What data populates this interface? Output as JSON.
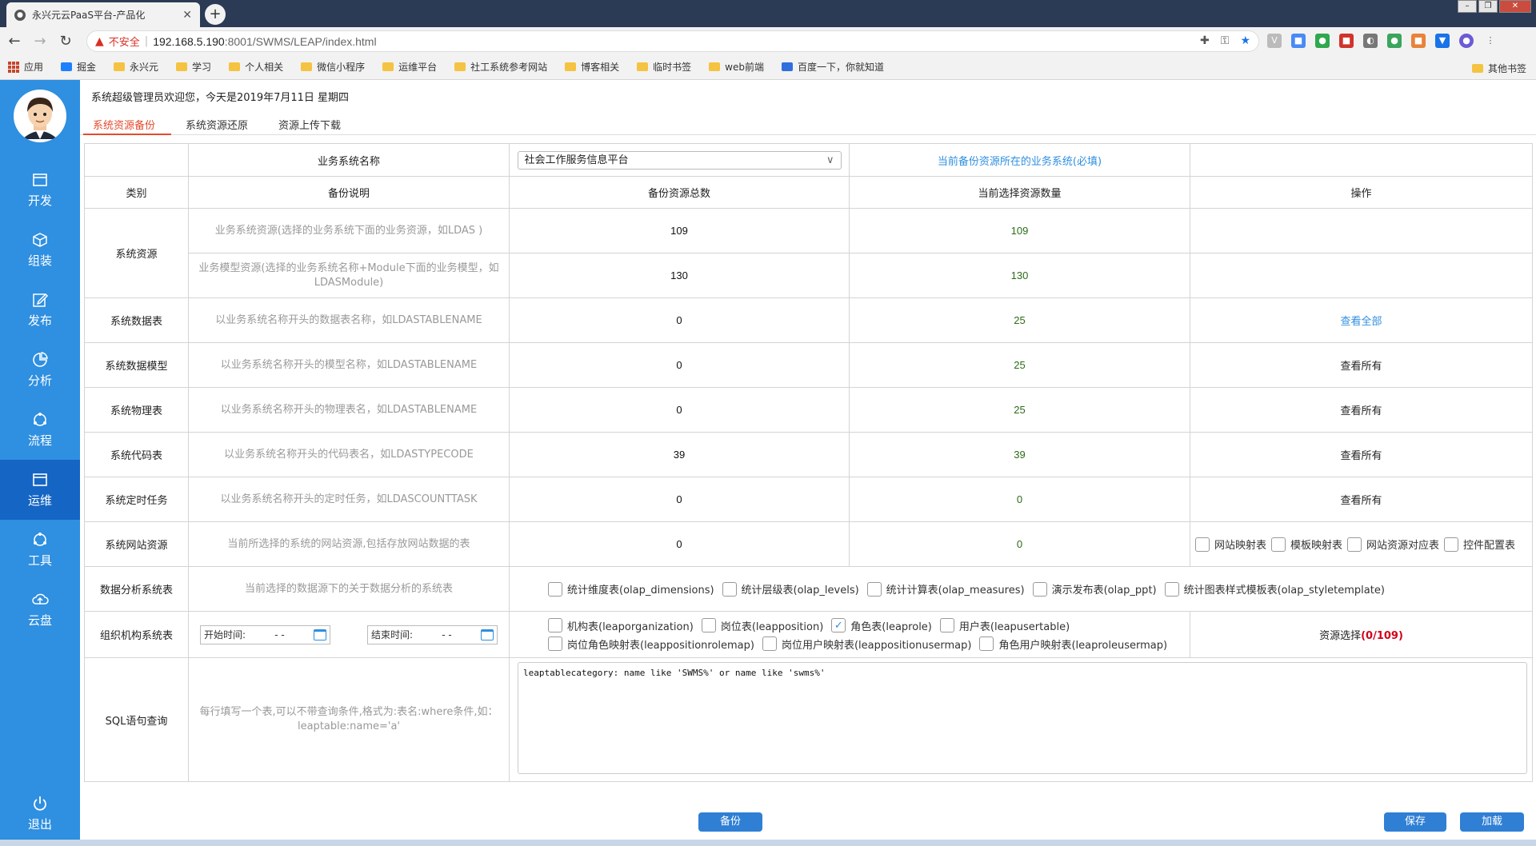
{
  "browser": {
    "tab_title": "永兴元云PaaS平台-产品化",
    "security_label": "不安全",
    "url_host": "192.168.5.190",
    "url_rest": ":8001/SWMS/LEAP/index.html"
  },
  "bookmarks": {
    "items": [
      "应用",
      "掘金",
      "永兴元",
      "学习",
      "个人相关",
      "微信小程序",
      "运维平台",
      "社工系统参考网站",
      "博客相关",
      "临时书签",
      "web前端",
      "百度一下，你就知道"
    ],
    "other": "其他书签"
  },
  "sidenav": {
    "items": [
      "开发",
      "组装",
      "发布",
      "分析",
      "流程",
      "运维",
      "工具",
      "云盘"
    ],
    "logout": "退出"
  },
  "header": {
    "welcome": "系统超级管理员欢迎您，今天是2019年7月11日 星期四"
  },
  "tabs": [
    "系统资源备份",
    "系统资源还原",
    "资源上传下载"
  ],
  "table": {
    "biz_name_label": "业务系统名称",
    "biz_name_value": "社会工作服务信息平台",
    "biz_name_hint": "当前备份资源所在的业务系统(必填)",
    "headers": [
      "类别",
      "备份说明",
      "备份资源总数",
      "当前选择资源数量",
      "操作"
    ],
    "sys_res_label": "系统资源",
    "rows": [
      {
        "desc": "业务系统资源(选择的业务系统下面的业务资源，如LDAS )",
        "total": "109",
        "selected": "109"
      },
      {
        "desc": "业务模型资源(选择的业务系统名称+Module下面的业务模型，如LDASModule)",
        "total": "130",
        "selected": "130"
      },
      {
        "cat": "系统数据表",
        "desc": "以业务系统名称开头的数据表名称，如LDASTABLENAME",
        "total": "0",
        "selected": "25",
        "action": "查看全部"
      },
      {
        "cat": "系统数据模型",
        "desc": "以业务系统名称开头的模型名称，如LDASTABLENAME",
        "total": "0",
        "selected": "25",
        "action": "查看所有"
      },
      {
        "cat": "系统物理表",
        "desc": "以业务系统名称开头的物理表名，如LDASTABLENAME",
        "total": "0",
        "selected": "25",
        "action": "查看所有"
      },
      {
        "cat": "系统代码表",
        "desc": "以业务系统名称开头的代码表名，如LDASTYPECODE",
        "total": "39",
        "selected": "39",
        "action": "查看所有"
      },
      {
        "cat": "系统定时任务",
        "desc": "以业务系统名称开头的定时任务，如LDASCOUNTTASK",
        "total": "0",
        "selected": "0",
        "action": "查看所有"
      },
      {
        "cat": "系统网站资源",
        "desc": "当前所选择的系统的网站资源,包括存放网站数据的表",
        "total": "0",
        "selected": "0"
      }
    ],
    "web_checks": [
      "网站映射表",
      "模板映射表",
      "网站资源对应表",
      "控件配置表"
    ],
    "olap": {
      "cat": "数据分析系统表",
      "desc": "当前选择的数据源下的关于数据分析的系统表",
      "checks": [
        "统计维度表(olap_dimensions)",
        "统计层级表(olap_levels)",
        "统计计算表(olap_measures)",
        "演示发布表(olap_ppt)",
        "统计图表样式模板表(olap_styletemplate)"
      ]
    },
    "org": {
      "cat": "组织机构系统表",
      "start_label": "开始时间:",
      "end_label": "结束时间:",
      "date_placeholder": "-    -",
      "checks": [
        "机构表(leaporganization)",
        "岗位表(leapposition)",
        "角色表(leaprole)",
        "用户表(leapusertable)",
        "岗位角色映射表(leappositionrolemap)",
        "岗位用户映射表(leappositionusermap)",
        "角色用户映射表(leaproleusermap)"
      ],
      "checked_index": 2,
      "res_select_label": "资源选择",
      "res_select_count": "(0/109)"
    },
    "sql": {
      "cat": "SQL语句查询",
      "desc": "每行填写一个表,可以不带查询条件,格式为:表名:where条件,如：leaptable:name='a'",
      "value": "leaptablecategory: name like 'SWMS%' or name like 'swms%'"
    }
  },
  "buttons": {
    "backup": "备份",
    "save": "保存",
    "load": "加载"
  },
  "colors": {
    "sidebar": "#2f8fe0",
    "sidebar_active": "#1565c4",
    "accent_tab": "#e64a2e",
    "selected_count": "#2c6b17",
    "button": "#2f7fd5"
  }
}
